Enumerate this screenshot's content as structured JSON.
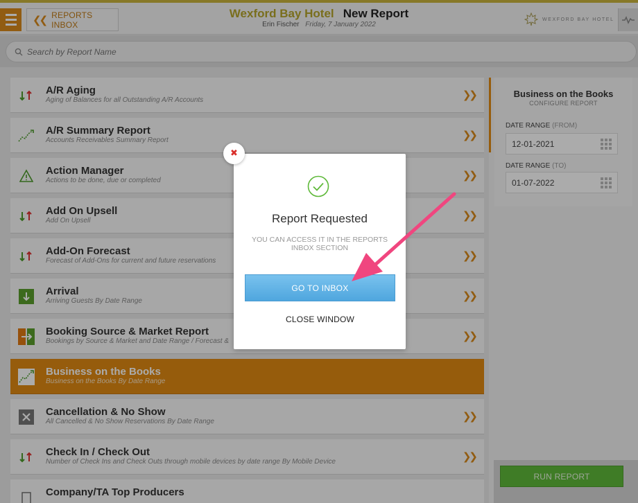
{
  "header": {
    "inbox_label": "REPORTS INBOX",
    "hotel_name": "Wexford Bay Hotel",
    "report_title": "New Report",
    "user_name": "Erin Fischer",
    "date": "Friday, 7 January 2022",
    "brand_text": "WEXFORD BAY HOTEL"
  },
  "search": {
    "placeholder": "Search by Report Name"
  },
  "reports": [
    {
      "name": "A/R Aging",
      "desc": "Aging of Balances for all Outstanding A/R Accounts",
      "icon": "updown-arrows-icon"
    },
    {
      "name": "A/R Summary Report",
      "desc": "Accounts Receivables Summary Report",
      "icon": "trend-line-icon"
    },
    {
      "name": "Action Manager",
      "desc": "Actions to be done, due or completed",
      "icon": "warning-triangle-icon"
    },
    {
      "name": "Add On Upsell",
      "desc": "Add On Upsell",
      "icon": "updown-arrows-icon"
    },
    {
      "name": "Add-On Forecast",
      "desc": "Forecast of Add-Ons for current and future reservations",
      "icon": "updown-arrows-icon"
    },
    {
      "name": "Arrival",
      "desc": "Arriving Guests By Date Range",
      "icon": "arrival-icon"
    },
    {
      "name": "Booking Source & Market Report",
      "desc": "Bookings by Source & Market and Date Range / Forecast &",
      "icon": "booking-source-icon"
    },
    {
      "name": "Business on the Books",
      "desc": "Business on the Books By Date Range",
      "icon": "trend-line-icon",
      "active": true
    },
    {
      "name": "Cancellation & No Show",
      "desc": "All Cancelled & No Show Reservations By Date Range",
      "icon": "cancel-x-icon"
    },
    {
      "name": "Check In / Check Out",
      "desc": "Number of Check Ins and Check Outs through mobile devices by date range By Mobile Device",
      "icon": "updown-arrows-icon"
    },
    {
      "name": "Company/TA Top Producers",
      "desc": "",
      "icon": "company-icon"
    }
  ],
  "side": {
    "title": "Business on the Books",
    "subtitle": "CONFIGURE REPORT",
    "from_label": "DATE RANGE",
    "from_paren": "(FROM)",
    "from_value": "12-01-2021",
    "to_label": "DATE RANGE",
    "to_paren": "(TO)",
    "to_value": "01-07-2022",
    "run_label": "RUN REPORT"
  },
  "modal": {
    "close_glyph": "✖",
    "title": "Report Requested",
    "message": "YOU CAN ACCESS IT IN THE REPORTS INBOX SECTION",
    "primary_label": "GO TO INBOX",
    "secondary_label": "CLOSE WINDOW"
  },
  "colors": {
    "accent_orange": "#e08a12",
    "hotel_gold": "#b5a42a",
    "run_green": "#5fb93a",
    "primary_blue": "#4fa6de",
    "annotation_pink": "#f0467f"
  }
}
